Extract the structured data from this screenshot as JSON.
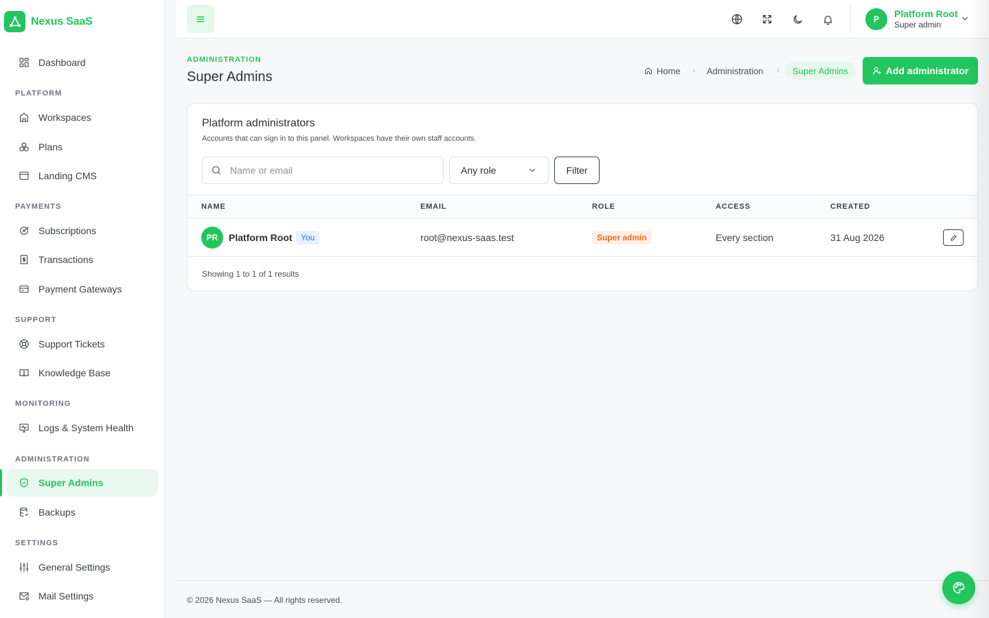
{
  "brand": {
    "name": "Nexus SaaS"
  },
  "sidebar": {
    "dashboard": "Dashboard",
    "sections": {
      "platform": "PLATFORM",
      "payments": "PAYMENTS",
      "support": "SUPPORT",
      "monitoring": "MONITORING",
      "administration": "ADMINISTRATION",
      "settings": "SETTINGS"
    },
    "items": {
      "workspaces": "Workspaces",
      "plans": "Plans",
      "landing_cms": "Landing CMS",
      "subscriptions": "Subscriptions",
      "transactions": "Transactions",
      "payment_gateways": "Payment Gateways",
      "support_tickets": "Support Tickets",
      "knowledge_base": "Knowledge Base",
      "logs": "Logs & System Health",
      "super_admins": "Super Admins",
      "backups": "Backups",
      "general_settings": "General Settings",
      "mail_settings": "Mail Settings"
    }
  },
  "topbar": {
    "user_initial": "P",
    "user_name": "Platform Root",
    "user_role": "Super admin"
  },
  "page": {
    "eyebrow": "ADMINISTRATION",
    "title": "Super Admins",
    "breadcrumb": {
      "home": "Home",
      "section": "Administration",
      "current": "Super Admins"
    },
    "add_button": "Add administrator"
  },
  "card": {
    "title": "Platform administrators",
    "subtitle": "Accounts that can sign in to this panel. Workspaces have their own staff accounts.",
    "search_placeholder": "Name or email",
    "role_select": "Any role",
    "filter_button": "Filter",
    "columns": {
      "name": "NAME",
      "email": "EMAIL",
      "role": "ROLE",
      "access": "ACCESS",
      "created": "CREATED"
    },
    "rows": [
      {
        "initials": "PR",
        "name": "Platform Root",
        "badge": "You",
        "email": "root@nexus-saas.test",
        "role": "Super admin",
        "access": "Every section",
        "created": "31 Aug 2026"
      }
    ],
    "showing": "Showing 1 to 1 of 1 results"
  },
  "footer": {
    "text": "© 2026 Nexus SaaS — All rights reserved."
  },
  "colors": {
    "accent": "#22c55e",
    "you_badge": "#2f6fd6",
    "role_badge": "#f26b1d"
  }
}
